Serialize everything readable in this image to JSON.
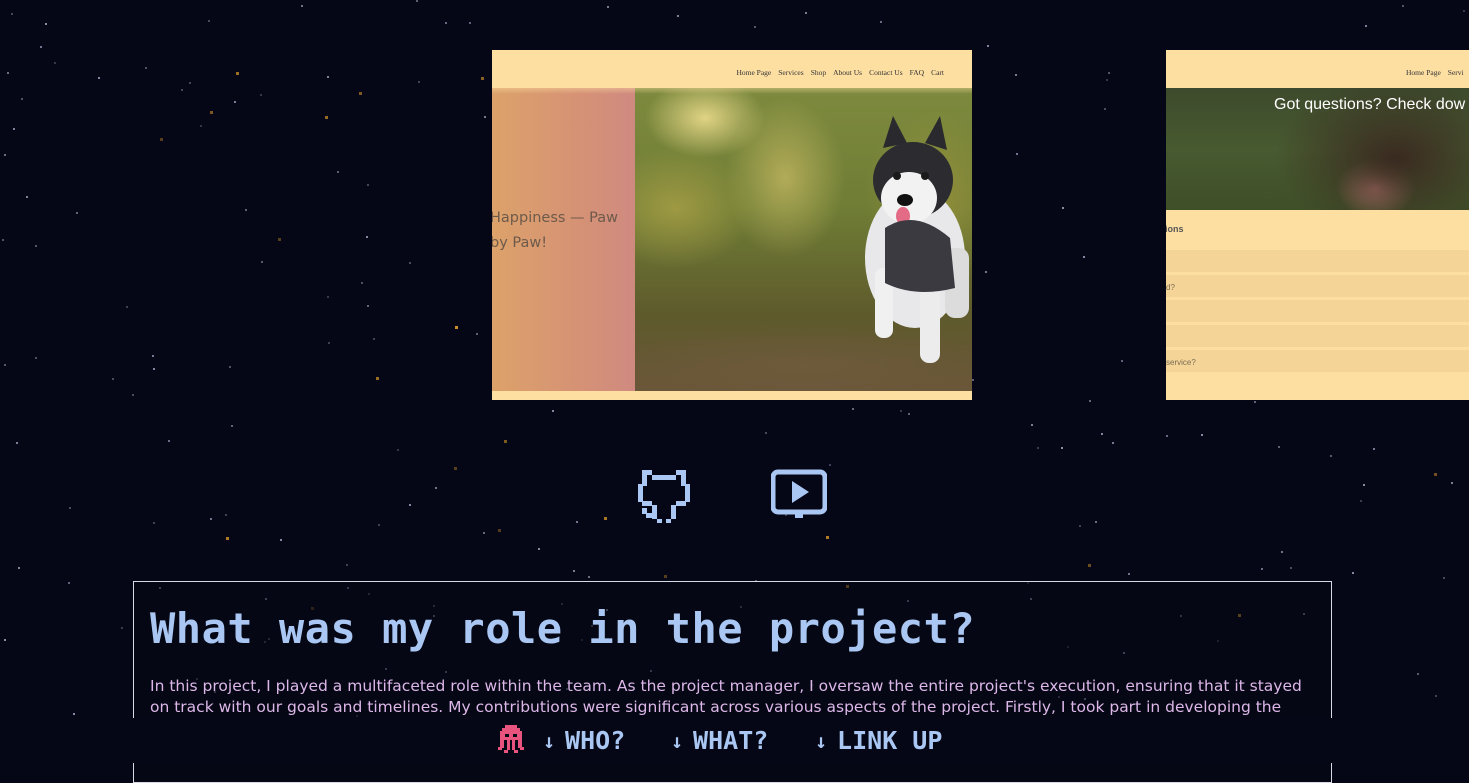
{
  "project_gallery": {
    "shot_home": {
      "nav": [
        "Home Page",
        "Services",
        "Shop",
        "About Us",
        "Contact Us",
        "FAQ",
        "Cart"
      ],
      "hero_text": "Happiness — Paw by Paw!"
    },
    "shot_faq": {
      "nav": [
        "Home Page",
        "Servi"
      ],
      "hero_text": "Got questions? Check dow",
      "heading": "estions",
      "rows": [
        "",
        "d?",
        "",
        "",
        "service?"
      ]
    }
  },
  "links": {
    "github_icon": "github-icon",
    "demo_icon": "play-video-icon"
  },
  "role": {
    "title": "What was my role in the project?",
    "text": "In this project, I played a multifaceted role within the team. As the project manager, I oversaw the entire project's execution, ensuring that it stayed on track with our goals and timelines. My contributions were significant across various aspects of the project. Firstly, I took part in developing the content inventory,"
  },
  "bottom_nav": {
    "logo_icon": "octopus-icon",
    "arrow_icon": "↓",
    "who": "WHO?",
    "what": "WHAT?",
    "link_up": "LINK UP"
  },
  "colors": {
    "background": "#050716",
    "accent_blue": "#a9c7f2",
    "body_text": "#dcb7e8",
    "octopus": "#e8547e"
  }
}
